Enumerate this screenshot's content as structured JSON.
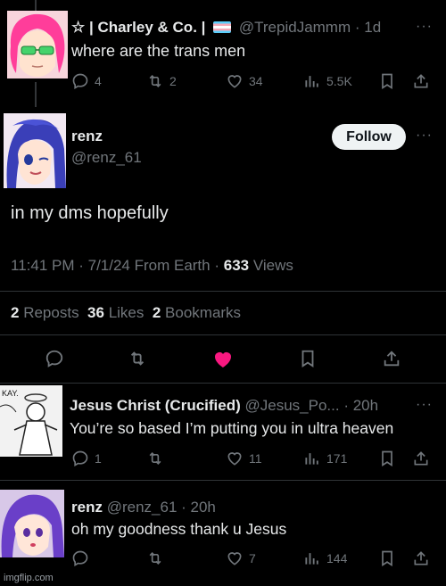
{
  "tweet1": {
    "name": "☆ | Charley & Co. |",
    "handle": "@TrepidJammm",
    "time": "1d",
    "text": "where are the trans men",
    "replies": "4",
    "reposts": "2",
    "likes": "34",
    "views": "5.5K"
  },
  "main": {
    "name": "renz",
    "handle": "@renz_61",
    "follow_label": "Follow",
    "text": "in my dms hopefully",
    "time": "11:41 PM · 7/1/24 From Earth ·",
    "views_count": "633",
    "views_label": "Views",
    "reposts_count": "2",
    "reposts_label": "Reposts",
    "likes_count": "36",
    "likes_label": "Likes",
    "bookmarks_count": "2",
    "bookmarks_label": "Bookmarks",
    "like_color": "#f91880"
  },
  "reply1": {
    "name": "Jesus Christ (Crucified)",
    "handle": "@Jesus_Po...",
    "time": "20h",
    "text": "You’re so based I’m putting you in ultra heaven",
    "replies": "1",
    "likes": "11",
    "views": "171",
    "avatar_text": "KAY."
  },
  "reply2": {
    "name": "renz",
    "handle": "@renz_61",
    "time": "20h",
    "text": "oh my goodness thank u Jesus",
    "likes": "7",
    "views": "144"
  },
  "watermark": "imgflip.com"
}
